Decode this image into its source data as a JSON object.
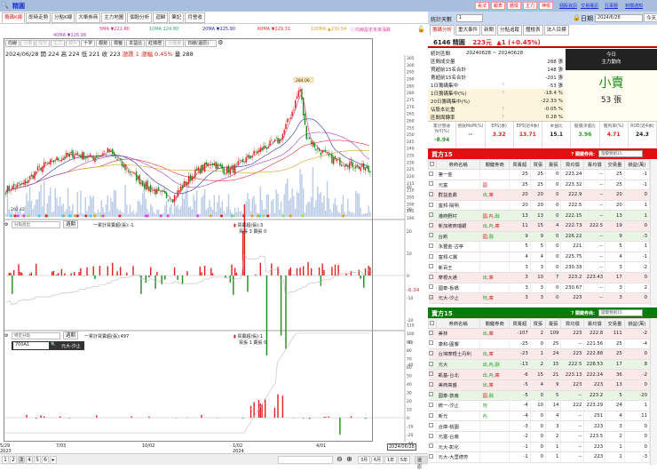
{
  "app": {
    "stock_name": "精圓"
  },
  "left_tabs": [
    "籌碼K線",
    "即時走勢",
    "分點K線",
    "大單券商",
    "主力地圖",
    "個股分析",
    "迴歸",
    "筆記",
    "月營收"
  ],
  "ma_legend": [
    {
      "label": "5MA ▼222.80",
      "color": "#e0306a"
    },
    {
      "label": "10MA 224.80",
      "color": "#2aa87a"
    },
    {
      "label": "20MA ▼225.90",
      "color": "#2a2aa8"
    },
    {
      "label": "60MA ▼229.31",
      "color": "#e03030"
    },
    {
      "label": "100MA ▲230.54",
      "color": "#e0a020"
    },
    {
      "label": "40MA ▼226.98",
      "color": "#a040c0"
    }
  ],
  "ma_note": "ⓘ均線設定未來漲跌",
  "chart_toolbar": {
    "buttons": [
      "均線",
      "分價",
      "成交",
      "主力",
      "散戶",
      "十字",
      "趨勢",
      "標籤",
      "本益比",
      "紅綠燈",
      "分價量"
    ],
    "disabled": [
      1,
      2,
      3,
      4,
      10
    ],
    "period": "日線(還原)"
  },
  "ohlc_info": {
    "text": "2024/06/28 開 224 高 224 低 221 收 223",
    "change": "漲跌 1 漲幅 0.45%",
    "volume": "量 288"
  },
  "main_chart": {
    "price_axis": [
      305,
      300,
      295,
      290,
      285,
      280,
      275,
      270,
      265,
      260,
      255,
      250,
      245,
      240,
      235,
      230,
      225,
      220,
      215,
      210,
      205,
      200,
      195,
      190
    ],
    "peak_label": "284.06",
    "low_label": "202.42",
    "price_path": [
      [
        0,
        210
      ],
      [
        20,
        214
      ],
      [
        40,
        226
      ],
      [
        60,
        232
      ],
      [
        80,
        236
      ],
      [
        100,
        233
      ],
      [
        120,
        238
      ],
      [
        135,
        228
      ],
      [
        150,
        220
      ],
      [
        165,
        212
      ],
      [
        180,
        207
      ],
      [
        195,
        204
      ],
      [
        205,
        212
      ],
      [
        220,
        222
      ],
      [
        240,
        230
      ],
      [
        255,
        224
      ],
      [
        265,
        225
      ],
      [
        280,
        232
      ],
      [
        300,
        240
      ],
      [
        320,
        246
      ],
      [
        335,
        268
      ],
      [
        343,
        284
      ],
      [
        350,
        250
      ],
      [
        362,
        240
      ],
      [
        380,
        232
      ],
      [
        400,
        229
      ],
      [
        415,
        226
      ],
      [
        425,
        223
      ]
    ]
  },
  "panel2": {
    "selector": "分點進出",
    "btn": "週期",
    "legend_cum": "一累計買賣超(張):-1",
    "legend_bar": "買賣超(張):3",
    "legend_sub": "買張 3 賣張 0",
    "axis": [
      40,
      30,
      20,
      10,
      0,
      -10,
      -20,
      -30,
      -40
    ],
    "last_value": "-6.34"
  },
  "panel3": {
    "selector": "特定分點",
    "btn": "週期",
    "broker_code": "700A1",
    "broker_name": "元大-汐止",
    "legend_cum": "一累計買賣超(張):497",
    "legend_bar": "買賣超(張):1",
    "legend_sub": "買張 1 賣張 0",
    "axis": [
      110,
      100,
      90,
      80,
      70,
      60,
      50,
      40,
      30,
      20,
      10,
      0,
      -10,
      -20,
      -30
    ]
  },
  "x_axis": [
    {
      "label": "5/29",
      "sub": "2023"
    },
    {
      "label": "7/03",
      "sub": ""
    },
    {
      "label": "10/02",
      "sub": ""
    },
    {
      "label": "1/02",
      "sub": "2024"
    },
    {
      "label": "4/01",
      "sub": ""
    }
  ],
  "x_axis_current": "2024/06/28",
  "bottom": {
    "pages": [
      "1",
      "2",
      "3",
      "4",
      "5",
      "6"
    ],
    "active_page": "3",
    "ranges": [
      "3月",
      "6月",
      "1年",
      "5年"
    ],
    "extra": "還原"
  },
  "right_nav": {
    "buttons": [
      "看法",
      "報表",
      "體檢",
      "主力",
      "神檢"
    ],
    "links": [
      "個股資訊",
      "交易權訊",
      "行事曆",
      "到價通知"
    ]
  },
  "stat_days": {
    "label": "統計天數",
    "value": "1",
    "date_label": "日期",
    "date": "2024/6/28",
    "today_btn": "今天"
  },
  "right_tabs": [
    "籌碼分析",
    "重大事件",
    "新聞",
    "分點追蹤",
    "體檢表",
    "法人目標"
  ],
  "stock_header": {
    "code_name": "6146 精圓",
    "price": "223元",
    "change": "▲1 (+0.45%)"
  },
  "stats": [
    {
      "label": "統計區間",
      "value": "20240628 ~ 20240628",
      "q": ""
    },
    {
      "label": "區間成交量",
      "value": "288 張",
      "q": ""
    },
    {
      "label": "買超前15名合計",
      "value": "148 張",
      "q": ""
    },
    {
      "label": "賣超前15名合計",
      "value": "-201 張",
      "q": ""
    },
    {
      "label": "1日籌碼集中",
      "value": "-53 張",
      "q": "?"
    },
    {
      "label": "1日籌碼集中(%)",
      "value": "-18.4 %",
      "q": "?"
    },
    {
      "label": "20日籌碼集中(%)",
      "value": "-22.33 %",
      "q": ""
    },
    {
      "label": "佔股本比重",
      "value": "-0.05 %",
      "q": "?"
    },
    {
      "label": "區間周轉率",
      "value": "0.28 %",
      "q": "?"
    }
  ],
  "main_force": {
    "title1": "今日",
    "title2": "主力動向",
    "verdict": "小賣",
    "amount": "53 張"
  },
  "fundamentals": [
    {
      "label": "累計營收YoY(%)",
      "value": "-8.94",
      "color": "#2a9a2a"
    },
    {
      "label": "營收MoM(%)",
      "value": "--",
      "color": "#555"
    },
    {
      "label": "EPS(季)",
      "value": "3.32",
      "color": "#e02020"
    },
    {
      "label": "EPS(近4季)",
      "value": "13.71",
      "color": "#e02020"
    },
    {
      "label": "本益比",
      "value": "15.1",
      "color": "#222"
    },
    {
      "label": "股價淨值比",
      "value": "3.96",
      "color": "#2a9a2a"
    },
    {
      "label": "殖利率(%)",
      "value": "4.71",
      "color": "#e02020"
    },
    {
      "label": "ROE(近4季)",
      "value": "24.3",
      "color": "#222"
    }
  ],
  "broker_columns": [
    "券商名稱",
    "關鍵券商",
    "買賣超",
    "買張",
    "賣張",
    "買均價",
    "賣均價",
    "交易量",
    "損益(萬)"
  ],
  "buy_table": {
    "title": "買方15",
    "key_label": "? 關鍵券商:",
    "key_select": "當變營組15",
    "color": "#e01010",
    "rows": [
      {
        "n": "第一金",
        "k": [],
        "v": [
          "25",
          "25",
          "0",
          "223.24",
          "--",
          "25",
          "-1"
        ],
        "t": ""
      },
      {
        "n": "元富",
        "k": [
          [
            "國",
            "r"
          ]
        ],
        "v": [
          "25",
          "25",
          "0",
          "223.32",
          "--",
          "25",
          "-1"
        ],
        "t": ""
      },
      {
        "n": "群益金鼎",
        "k": [
          [
            "出,",
            "g"
          ],
          [
            "庫",
            "r"
          ]
        ],
        "v": [
          "20",
          "20",
          "0",
          "222.9",
          "--",
          "20",
          "0"
        ],
        "t": "pink"
      },
      {
        "n": "富邦-陽明",
        "k": [],
        "v": [
          "20",
          "20",
          "0",
          "222.5",
          "--",
          "20",
          "1"
        ],
        "t": ""
      },
      {
        "n": "港商野村",
        "k": [
          [
            "國,內,",
            "r"
          ],
          [
            "融",
            "g"
          ]
        ],
        "v": [
          "13",
          "13",
          "0",
          "222.15",
          "--",
          "13",
          "1"
        ],
        "t": "green"
      },
      {
        "n": "新加坡商瑞銀",
        "k": [
          [
            "出,內,",
            "g"
          ],
          [
            "庫",
            "r"
          ]
        ],
        "v": [
          "11",
          "15",
          "4",
          "222.73",
          "222.5",
          "19",
          "0"
        ],
        "t": "pink"
      },
      {
        "n": "台新",
        "k": [
          [
            "國,",
            "r"
          ],
          [
            "融",
            "g"
          ]
        ],
        "v": [
          "9",
          "9",
          "0",
          "226.22",
          "--",
          "9",
          "-3"
        ],
        "t": "green"
      },
      {
        "n": "永豐金-古亭",
        "k": [],
        "v": [
          "5",
          "5",
          "0",
          "221",
          "--",
          "5",
          "1"
        ],
        "t": ""
      },
      {
        "n": "富邦-C翼",
        "k": [],
        "v": [
          "4",
          "4",
          "0",
          "225.75",
          "--",
          "4",
          "-1"
        ],
        "t": ""
      },
      {
        "n": "新百王",
        "k": [],
        "v": [
          "3",
          "3",
          "0",
          "230.33",
          "--",
          "3",
          "-2"
        ],
        "t": ""
      },
      {
        "n": "摩根大通",
        "k": [
          [
            "出,",
            "g"
          ],
          [
            "庫",
            "r"
          ]
        ],
        "v": [
          "3",
          "10",
          "7",
          "223.2",
          "223.43",
          "17",
          "0"
        ],
        "t": "pink"
      },
      {
        "n": "國泰-板橋",
        "k": [],
        "v": [
          "3",
          "3",
          "0",
          "230.67",
          "--",
          "3",
          "2"
        ],
        "t": ""
      },
      {
        "n": "元大-汐止",
        "k": [
          [
            "地,",
            "g"
          ],
          [
            "庫",
            "r"
          ]
        ],
        "v": [
          "3",
          "3",
          "0",
          "223",
          "--",
          "3",
          "0"
        ],
        "t": "pink",
        "checked": true
      }
    ]
  },
  "sell_table": {
    "title": "賣方15",
    "key_label": "? 關鍵券商:",
    "key_select": "當變營組15",
    "color": "#0a7a0a",
    "rows": [
      {
        "n": "美林",
        "k": [
          [
            "出,",
            "g"
          ],
          [
            "庫",
            "r"
          ]
        ],
        "v": [
          "-107",
          "2",
          "109",
          "223",
          "222.8",
          "111",
          "-2"
        ],
        "t": "pink"
      },
      {
        "n": "康和-圓饗",
        "k": [],
        "v": [
          "-25",
          "0",
          "25",
          "--",
          "221.56",
          "25",
          "-4"
        ],
        "t": ""
      },
      {
        "n": "台灣摩根士丹利",
        "k": [
          [
            "出,",
            "g"
          ],
          [
            "庫",
            "r"
          ]
        ],
        "v": [
          "-23",
          "1",
          "24",
          "223",
          "222.88",
          "25",
          "0"
        ],
        "t": "pink"
      },
      {
        "n": "元大",
        "k": [
          [
            "出,內,",
            "g"
          ],
          [
            "融",
            "g"
          ]
        ],
        "v": [
          "-13",
          "2",
          "15",
          "222.5",
          "228.53",
          "17",
          "8"
        ],
        "t": "green"
      },
      {
        "n": "凱基-台北",
        "k": [
          [
            "出,內,",
            "g"
          ],
          [
            "庫",
            "r"
          ]
        ],
        "v": [
          "-6",
          "15",
          "21",
          "223.13",
          "222.24",
          "36",
          "-2"
        ],
        "t": "pink"
      },
      {
        "n": "美商高盛",
        "k": [
          [
            "出,",
            "g"
          ],
          [
            "庫",
            "r"
          ]
        ],
        "v": [
          "-5",
          "4",
          "9",
          "223",
          "223",
          "13",
          "0"
        ],
        "t": "pink"
      },
      {
        "n": "國泰-敦南",
        "k": [
          [
            "國,",
            "r"
          ],
          [
            "融",
            "g"
          ]
        ],
        "v": [
          "-5",
          "0",
          "5",
          "--",
          "223.2",
          "5",
          "-20"
        ],
        "t": "green"
      },
      {
        "n": "統一-汐止",
        "k": [
          [
            "地",
            "g"
          ]
        ],
        "v": [
          "-4",
          "10",
          "14",
          "222",
          "223.29",
          "24",
          "1"
        ],
        "t": ""
      },
      {
        "n": "新光",
        "k": [
          [
            "內",
            "g"
          ]
        ],
        "v": [
          "-4",
          "0",
          "4",
          "--",
          "251",
          "4",
          "11"
        ],
        "t": ""
      },
      {
        "n": "合庫-桃園",
        "k": [],
        "v": [
          "-3",
          "0",
          "3",
          "--",
          "223",
          "3",
          "0"
        ],
        "t": ""
      },
      {
        "n": "元富-台南",
        "k": [],
        "v": [
          "-2",
          "0",
          "2",
          "--",
          "223.5",
          "2",
          "0"
        ],
        "t": ""
      },
      {
        "n": "元大-彰化",
        "k": [],
        "v": [
          "-1",
          "0",
          "1",
          "--",
          "223",
          "1",
          "0"
        ],
        "t": ""
      },
      {
        "n": "元大-大里德芳",
        "k": [],
        "v": [
          "-1",
          "0",
          "1",
          "--",
          "223",
          "1",
          "-3"
        ],
        "t": ""
      }
    ]
  }
}
